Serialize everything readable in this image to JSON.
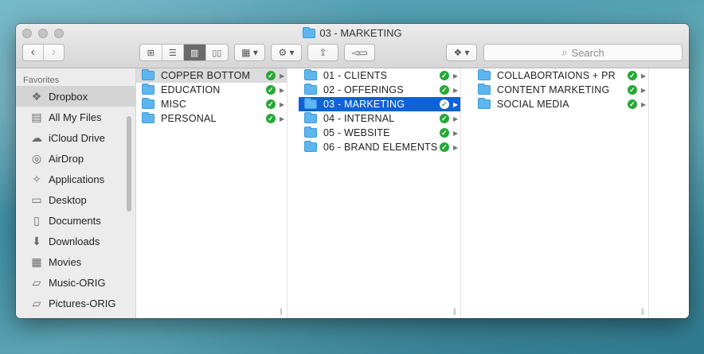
{
  "window": {
    "title": "03 - MARKETING"
  },
  "toolbar": {
    "back_icon": "chevron-left",
    "forward_icon": "chevron-right",
    "view_icons": [
      "icon-view",
      "list-view",
      "column-view",
      "cover-flow-view"
    ],
    "search_placeholder": "Search"
  },
  "sidebar": {
    "heading": "Favorites",
    "items": [
      {
        "label": "Dropbox",
        "icon": "dropbox-icon",
        "glyph": "❖"
      },
      {
        "label": "All My Files",
        "icon": "all-files-icon",
        "glyph": "▤"
      },
      {
        "label": "iCloud Drive",
        "icon": "cloud-icon",
        "glyph": "☁"
      },
      {
        "label": "AirDrop",
        "icon": "airdrop-icon",
        "glyph": "◎"
      },
      {
        "label": "Applications",
        "icon": "applications-icon",
        "glyph": "✧"
      },
      {
        "label": "Desktop",
        "icon": "desktop-icon",
        "glyph": "▭"
      },
      {
        "label": "Documents",
        "icon": "documents-icon",
        "glyph": "▯"
      },
      {
        "label": "Downloads",
        "icon": "downloads-icon",
        "glyph": "⬇"
      },
      {
        "label": "Movies",
        "icon": "movies-icon",
        "glyph": "▦"
      },
      {
        "label": "Music-ORIG",
        "icon": "folder-icon",
        "glyph": "▱"
      },
      {
        "label": "Pictures-ORIG",
        "icon": "folder-icon",
        "glyph": "▱"
      }
    ]
  },
  "columns": [
    {
      "items": [
        "COPPER BOTTOM",
        "EDUCATION",
        "MISC",
        "PERSONAL"
      ]
    },
    {
      "items": [
        "01 - CLIENTS",
        "02 - OFFERINGS",
        "03 - MARKETING",
        "04 - INTERNAL",
        "05 - WEBSITE",
        "06 - BRAND ELEMENTS"
      ]
    },
    {
      "items": [
        "COLLABORTAIONS + PR",
        "CONTENT MARKETING",
        "SOCIAL MEDIA"
      ]
    }
  ],
  "colors": {
    "selection_blue": "#0f62d6",
    "sync_green": "#27a737",
    "folder_blue": "#5fb6ee"
  }
}
